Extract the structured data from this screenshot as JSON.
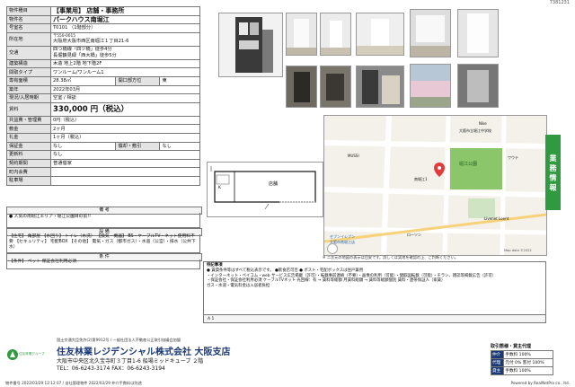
{
  "doc_id": "7381231",
  "info": {
    "rows": [
      {
        "label": "物件種目",
        "value": "【事業用】 店舗・事務所"
      },
      {
        "label": "物件名",
        "value": "パークハウス南堀江"
      },
      {
        "label": "号室名",
        "value": "T0101 （1階部分）"
      },
      {
        "label": "所在地",
        "postal": "〒550-0015",
        "value": "大阪府大阪市西区南堀江１丁目21-6"
      },
      {
        "label": "交通",
        "value": "四つ橋線「四ツ橋」徒歩4分",
        "value2": "長堀鶴見緑「西大橋」徒歩5分"
      },
      {
        "label": "建築構造",
        "value": "木造 地上2階 地下階2F"
      },
      {
        "label": "間取タイプ",
        "value": "ワンルーム/ワンルーム1"
      },
      {
        "label": "専有面積",
        "value": "28.38㎡",
        "extra_label": "開口部方位",
        "extra_value": "東"
      },
      {
        "label": "築年",
        "value": "2022年03月"
      },
      {
        "label": "現況/入居時期",
        "value": "空室 / 相談"
      },
      {
        "label": "賃料",
        "value": "330,000 円（税込）"
      },
      {
        "label": "共益費・管理費",
        "value": "0円（税込）"
      },
      {
        "label": "敷金",
        "value": "2ヶ月"
      },
      {
        "label": "礼金",
        "value": "1ヶ月（税込）"
      },
      {
        "label": "保証金",
        "value": "なし",
        "extra_label": "償却・敷引",
        "extra_value": "なし"
      },
      {
        "label": "更新料",
        "value": "なし"
      },
      {
        "label": "契約期間",
        "value": "普通借家"
      },
      {
        "label": "町内会費",
        "value": ""
      },
      {
        "label": "駐車場",
        "value": ""
      }
    ]
  },
  "features": {
    "head": "備 考",
    "lines": [
      "● 人気の南堀江エリア・堀江公園目の前!!"
    ]
  },
  "equipment": {
    "head": "設 備",
    "text": "【住宅】 角部屋 【水回り】 トイレ（水洗） 【換気・機器】 BS・ケーブルTV・ネット使用料不要 【セキュリティ】 宅配BOX 【その他】 電気・ガス（都市ガス）・水道（公営）・排水（公共下水）"
  },
  "conditions": {
    "head": "条 件",
    "text": "【条件】 ペット 保証会社利用必須"
  },
  "floorplan": {
    "room_label": "店舗",
    "k_label": "K"
  },
  "map": {
    "labels": [
      "堀江公園",
      "南堀江1",
      "MUSSI",
      "Nike",
      "大阪市立堀江中学校",
      "ワウテ",
      "セブンイレブン",
      "大阪市南堀江店",
      "ローソン",
      "Livenet Loent",
      "Map data ©2022"
    ],
    "note": "※ 二次元の地図の表示は目安です。詳しくは実地を確認の上、ご判断ください。"
  },
  "notes": {
    "title": "特記事項",
    "lines": [
      "● 賃貸条件等はすべて税込表示です。 ●飲食店可否 ● ポスト・宅配ボックスは住戸兼用",
      "・インターネット・ペイコム・web サービス広告掲載（許可）・転載事前連絡（不要）・画像の利用（可能）・間取図転載（可能）・チラシ、雑誌等掲載広告（許可）",
      "・保証会社・保証会社利用必須 ケーブルTVネット 光回線：有 → 賃料等総額 月賃料総額 → 賃料等総額個別 賃料・連帯保証人（家賃）",
      "ガス・水道・電気料金は入居者負担"
    ],
    "footer": "A 1"
  },
  "side_tab": "業 務 情 報",
  "company": {
    "license": "国土交通大臣免許(2)第9912号 / 一般社団法人不動産公正取引協議会加盟",
    "name": "住友林業レジデンシャル株式会社 大阪支店",
    "address": "大阪市中央区北久宝寺町３丁目1-6 船場ミッドキューブ ２階",
    "tel": "TEL：06-6243-3174 FAX：06-6243-3194",
    "logo_text": "住友林業グループ"
  },
  "fee": {
    "title": "取引態様・貸主代理",
    "rows": [
      {
        "label": "仲介",
        "value": "手数料 100%"
      },
      {
        "label": "代理",
        "value": "元付 0% 客付 100%"
      },
      {
        "label": "貸主",
        "value": "手数料 100%"
      }
    ]
  },
  "footer": {
    "left": "物件番号 2022/03/29 12:12 07 / 自社管理物件 2022/03/29 仲介手数料は別途",
    "right": "Powered by RealNetPro co., ltd."
  },
  "colors": {
    "accent_green": "#2f9a3f",
    "company_blue": "#1a3a77",
    "park_green": "#8cc66a"
  }
}
